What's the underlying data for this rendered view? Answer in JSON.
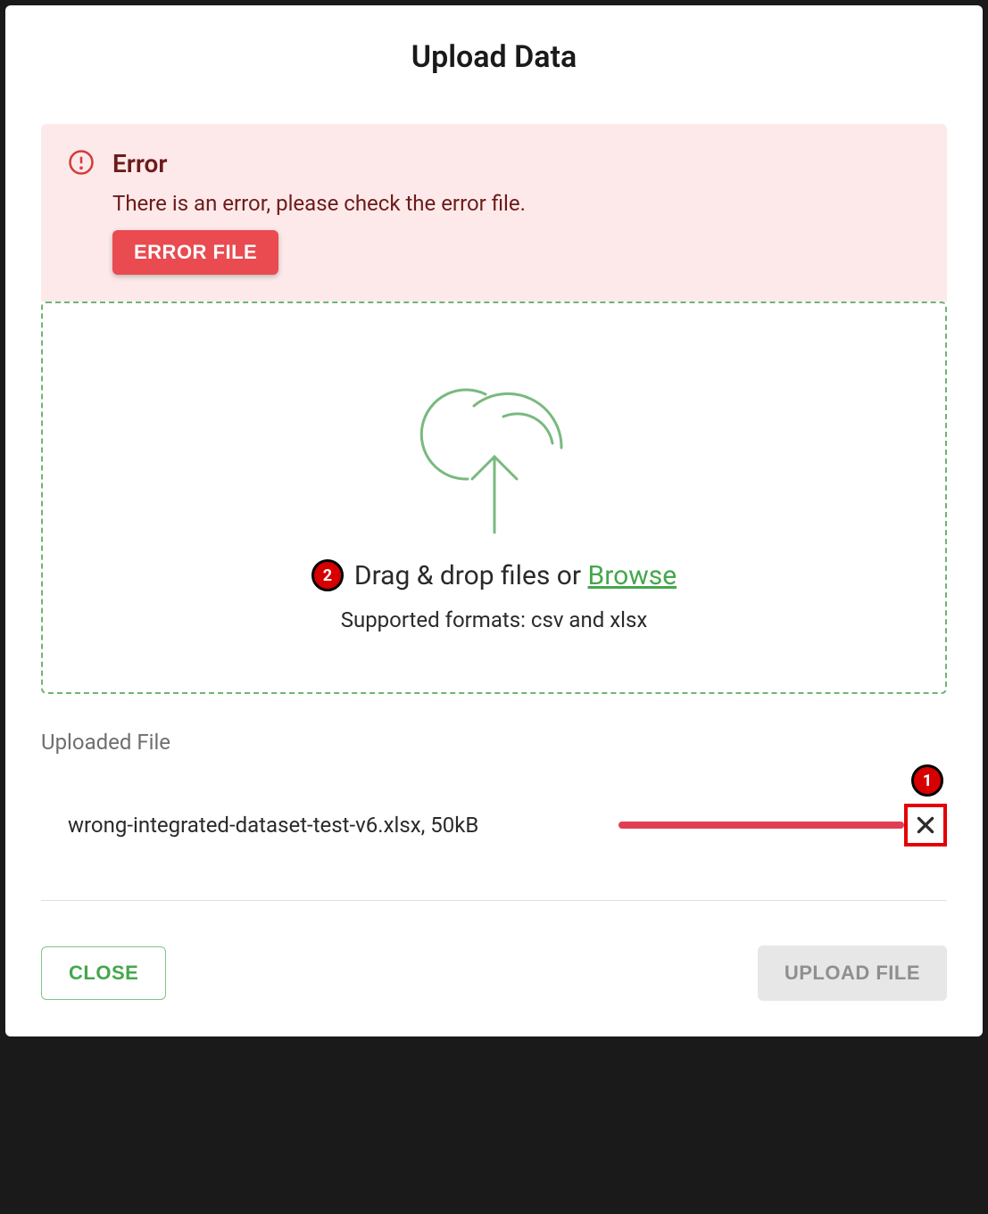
{
  "modal": {
    "title": "Upload Data"
  },
  "alert": {
    "title": "Error",
    "message": "There is an error, please check the error file.",
    "button_label": "ERROR FILE"
  },
  "dropzone": {
    "text_prefix": "Drag & drop files or ",
    "browse_label": "Browse",
    "hint": "Supported formats: csv and xlsx"
  },
  "uploaded": {
    "section_label": "Uploaded File",
    "file_text": "wrong-integrated-dataset-test-v6.xlsx, 50kB"
  },
  "actions": {
    "close_label": "CLOSE",
    "upload_label": "UPLOAD FILE"
  },
  "annotations": {
    "marker_1": "1",
    "marker_2": "2"
  },
  "colors": {
    "accent_green": "#45A74C",
    "error_red": "#E94B50",
    "alert_bg": "#FDE9E9"
  }
}
